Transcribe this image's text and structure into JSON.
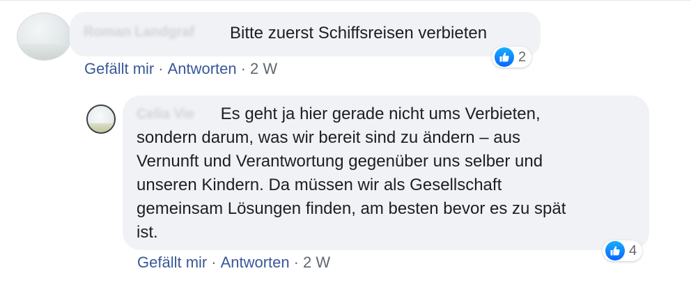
{
  "comments": [
    {
      "author_obscured": "Roman Landgraf",
      "text": "Bitte zuerst Schiffsreisen verbieten",
      "reactions": {
        "icon": "like-icon",
        "count": "2"
      },
      "actions": {
        "like": "Gefällt mir",
        "reply": "Antworten",
        "separator": "·",
        "time": "2 W"
      }
    },
    {
      "author_obscured": "Celia Vie",
      "text_lines": [
        "Es geht ja hier gerade nicht ums Verbieten,",
        "sondern darum, was wir bereit sind zu ändern – aus",
        "Vernunft und Verantwortung gegenüber uns selber und",
        "unseren Kindern. Da müssen wir als Gesellschaft",
        "gemeinsam Lösungen finden, am besten bevor es zu spät",
        "ist."
      ],
      "reactions": {
        "icon": "like-icon",
        "count": "4"
      },
      "actions": {
        "like": "Gefällt mir",
        "reply": "Antworten",
        "separator": "·",
        "time": "2 W"
      }
    }
  ],
  "colors": {
    "bubble": "#f0f2f5",
    "link": "#385898",
    "meta": "#606770",
    "like_blue": "#0866ff"
  }
}
